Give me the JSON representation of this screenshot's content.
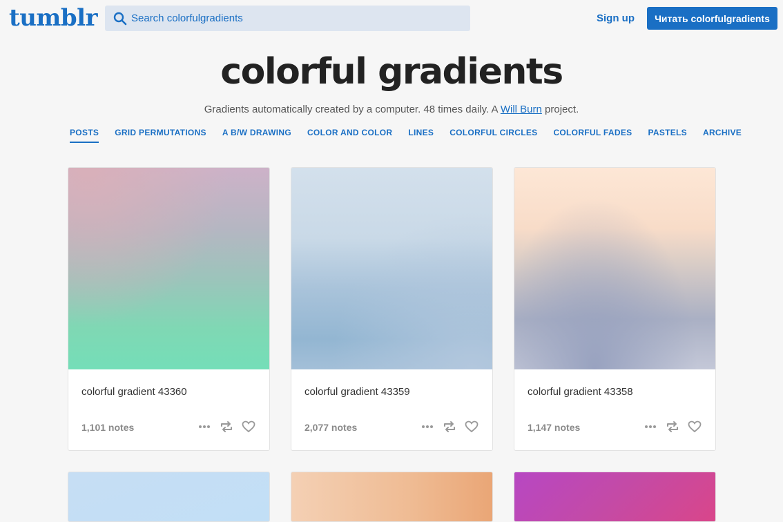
{
  "header": {
    "logo": "tumblr",
    "search_placeholder": "Search colorfulgradients",
    "signup_label": "Sign up",
    "follow_label": "Читать colorfulgradients"
  },
  "blog": {
    "title": "colorful gradients",
    "description_before": "Gradients automatically created by a computer. 48 times daily. A ",
    "description_link": "Will Burn",
    "description_after": " project."
  },
  "nav": [
    {
      "label": "POSTS",
      "active": true
    },
    {
      "label": "GRID PERMUTATIONS"
    },
    {
      "label": "A B/W DRAWING"
    },
    {
      "label": "COLOR AND COLOR"
    },
    {
      "label": "LINES"
    },
    {
      "label": "COLORFUL CIRCLES"
    },
    {
      "label": "COLORFUL FADES"
    },
    {
      "label": "PASTELS"
    },
    {
      "label": "ARCHIVE"
    }
  ],
  "posts": [
    {
      "title": "colorful gradient 43360",
      "notes": "1,101 notes"
    },
    {
      "title": "colorful gradient 43359",
      "notes": "2,077 notes"
    },
    {
      "title": "colorful gradient 43358",
      "notes": "1,147 notes"
    }
  ],
  "colors": {
    "accent": "#1a6fc4",
    "background": "#f6f6f6"
  },
  "icons": {
    "search": "search-icon",
    "more": "more-icon",
    "reblog": "reblog-icon",
    "like": "heart-icon"
  }
}
